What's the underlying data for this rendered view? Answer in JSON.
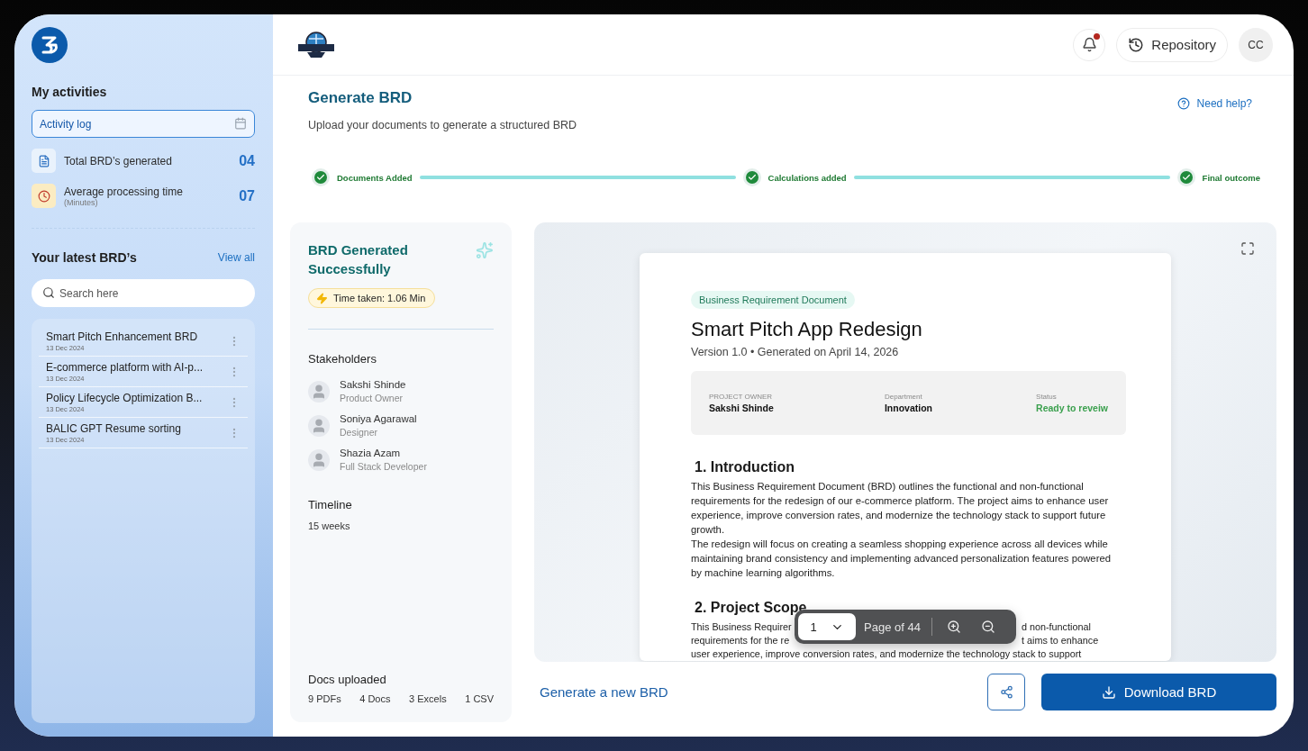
{
  "sidebar": {
    "activities_title": "My activities",
    "activity_log": {
      "value": "Activity log"
    },
    "stats": [
      {
        "kind": "document",
        "label": "Total BRD’s generated",
        "value": "04"
      },
      {
        "kind": "clock",
        "label": "Average processing time",
        "sublabel": "(Minutes)",
        "value": "07"
      }
    ],
    "latest_title": "Your latest BRD’s",
    "view_all": "View all",
    "search": {
      "placeholder": "Search here"
    },
    "brds": [
      {
        "title": "Smart Pitch Enhancement BRD",
        "date": "13 Dec 2024"
      },
      {
        "title": "E-commerce platform with AI-p...",
        "date": "13 Dec 2024"
      },
      {
        "title": "Policy Lifecycle Optimization B...",
        "date": "13 Dec 2024"
      },
      {
        "title": "BALIC GPT Resume sorting",
        "date": "13 Dec 2024"
      }
    ]
  },
  "header": {
    "notification_unread": true,
    "repository": "Repository",
    "avatar": "CC"
  },
  "page": {
    "title": "Generate BRD",
    "subtitle": "Upload your documents to generate a structured BRD",
    "help": "Need help?"
  },
  "steps": [
    {
      "label": "Documents Added",
      "done": true
    },
    {
      "label": "Calculations added",
      "done": true
    },
    {
      "label": "Final outcome",
      "done": true
    }
  ],
  "summary": {
    "title": "BRD Generated Successfully",
    "time_taken": "Time taken: 1.06 Min",
    "stakeholders_title": "Stakeholders",
    "stakeholders": [
      {
        "name": "Sakshi Shinde",
        "role": "Product Owner"
      },
      {
        "name": "Soniya Agarawal",
        "role": "Designer"
      },
      {
        "name": "Shazia Azam",
        "role": "Full Stack Developer"
      }
    ],
    "timeline_title": "Timeline",
    "timeline": "15 weeks",
    "docs_title": "Docs uploaded",
    "docs": [
      "9 PDFs",
      "4 Docs",
      "3 Excels",
      "1 CSV"
    ]
  },
  "preview": {
    "badge": "Business Requirement Document",
    "title": "Smart Pitch App Redesign",
    "meta": "Version 1.0 • Generated on April 14, 2026",
    "info": [
      {
        "kind": "plain",
        "label": "PROJECT OWNER",
        "value": "Sakshi Shinde"
      },
      {
        "kind": "plain",
        "label": "Department",
        "value": "Innovation"
      },
      {
        "kind": "status",
        "label": "Status",
        "value": "Ready to reveiw"
      }
    ],
    "intro": {
      "heading": "1. Introduction",
      "paragraphs": [
        "This Business Requirement Document (BRD) outlines the functional and non-functional requirements for the redesign of our e-commerce platform. The project aims to enhance user experience, improve conversion rates, and modernize the technology stack to support future growth.",
        "The redesign will focus on creating a seamless shopping experience across all devices while maintaining brand consistency and implementing advanced personalization features powered by machine learning algorithms."
      ]
    },
    "scope": {
      "heading": "2. Project Scope",
      "lines": [
        {
          "left": "This Business Requirer",
          "right": "d non-functional"
        },
        {
          "left": "requirements for the re",
          "right": "t aims to enhance"
        },
        {
          "left": "user experience, improve conversion rates, and modernize the technology stack to support"
        }
      ]
    },
    "toolbar": {
      "page": "1",
      "page_label": "Page of 44"
    }
  },
  "footer": {
    "generate_link": "Generate a new BRD",
    "download": "Download BRD"
  }
}
